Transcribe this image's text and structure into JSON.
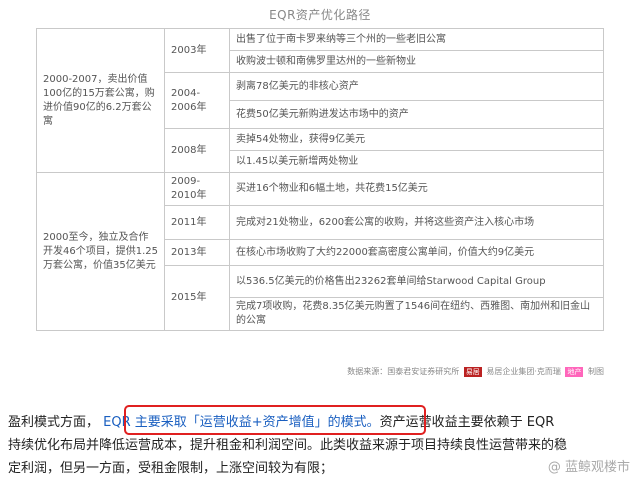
{
  "title": "EQR资产优化路径",
  "table": {
    "groups": [
      {
        "period": "2000-2007，卖出价值100亿的15万套公寓，购进价值90亿的6.2万套公寓",
        "years": [
          {
            "year": "2003年",
            "actions": [
              "出售了位于南卡罗来纳等三个州的一些老旧公寓",
              "收购波士顿和南佛罗里达州的一些新物业"
            ]
          },
          {
            "year": "2004-2006年",
            "actions": [
              "剥离78亿美元的非核心资产",
              "花费50亿美元新购进发达市场中的资产"
            ]
          },
          {
            "year": "2008年",
            "actions": [
              "卖掉54处物业，获得9亿美元",
              "以1.45以美元新增两处物业"
            ]
          }
        ]
      },
      {
        "period": "2000至今，独立及合作开发46个项目，提供1.25万套公寓，价值35亿美元",
        "years": [
          {
            "year": "2009-2010年",
            "actions": [
              "买进16个物业和6幅土地，共花费15亿美元"
            ]
          },
          {
            "year": "2011年",
            "actions": [
              "完成对21处物业，6200套公寓的收购，并将这些资产注入核心市场"
            ]
          },
          {
            "year": "2013年",
            "actions": [
              "在核心市场收购了大约22000套高密度公寓单间，价值大约9亿美元"
            ]
          },
          {
            "year": "2015年",
            "actions": [
              "以536.5亿美元的价格售出23262套单间给Starwood Capital Group",
              "完成7项收购，花费8.35亿美元购置了1546间在纽约、西雅图、南加州和旧金山的公寓"
            ]
          }
        ]
      }
    ]
  },
  "source": {
    "prefix": "数据来源：国泰君安证券研究所",
    "logo1": "易居",
    "middle": "易居企业集团·克而瑞",
    "logo2": "地产",
    "suffix": "制图"
  },
  "paragraph": {
    "line1_prefix": "盈利模式方面，",
    "line1_highlight": "EQR 主要采取「运营收益+资产增值」的模式。",
    "line1_suffix": "资产运营收益主要依赖于 EQR",
    "line2": "持续优化布局并降低运营成本，提升租金和利润空间。此类收益来源于项目持续良性运营带来的稳",
    "line3": "定利润，但另一方面，受租金限制，上涨空间较为有限；"
  },
  "watermark": "@ 蓝鲸观楼市",
  "colors": {
    "highlight_border": "#e02020",
    "highlight_text": "#1a5fc0",
    "table_border": "#c9c9c9"
  }
}
